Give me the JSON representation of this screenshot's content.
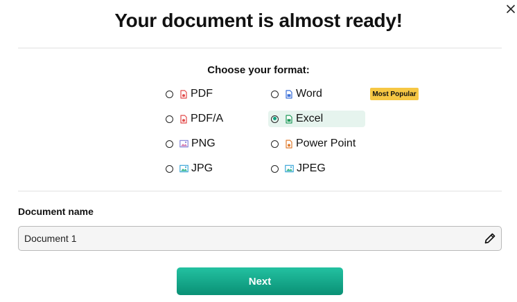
{
  "dialog": {
    "title": "Your document is almost ready!",
    "close_icon": "close-icon"
  },
  "format": {
    "heading": "Choose your format:",
    "selected": "Excel",
    "badge": "Most Popular",
    "options": [
      {
        "label": "PDF",
        "icon": "pdf-file-icon",
        "icon_color": "#e24a4a"
      },
      {
        "label": "Word",
        "icon": "word-file-icon",
        "icon_color": "#3b6fd8"
      },
      {
        "label": "PDF/A",
        "icon": "pdfa-file-icon",
        "icon_color": "#e24a4a"
      },
      {
        "label": "Excel",
        "icon": "excel-file-icon",
        "icon_color": "#1f9a5a"
      },
      {
        "label": "PNG",
        "icon": "png-image-icon",
        "icon_color": "#7a7ad6"
      },
      {
        "label": "Power Point",
        "icon": "powerpoint-file-icon",
        "icon_color": "#e07b2e"
      },
      {
        "label": "JPG",
        "icon": "jpg-image-icon",
        "icon_color": "#2a9fd6"
      },
      {
        "label": "JPEG",
        "icon": "jpeg-image-icon",
        "icon_color": "#2a9fd6"
      }
    ]
  },
  "document": {
    "label": "Document name",
    "value": "Document 1",
    "edit_icon": "pencil-icon"
  },
  "actions": {
    "next_label": "Next"
  },
  "colors": {
    "accent": "#12a88a",
    "selected_bg": "#e6f4ee",
    "badge_bg": "#f6c744"
  }
}
